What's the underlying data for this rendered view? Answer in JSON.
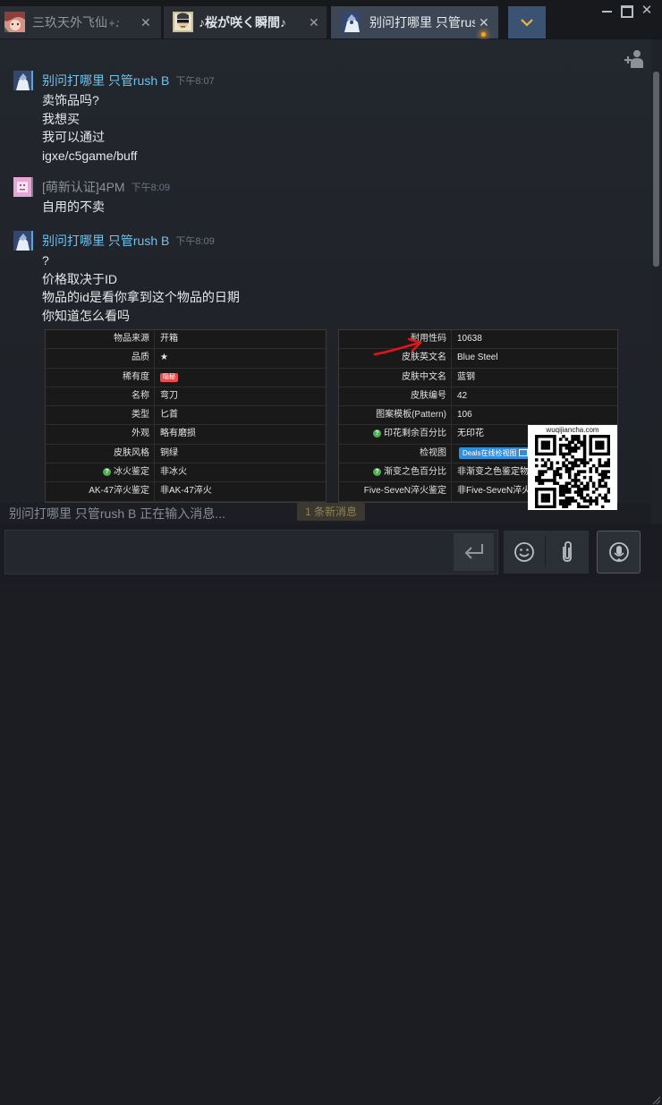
{
  "tabs": [
    {
      "label": "三玖天外飞仙",
      "active": false
    },
    {
      "label": "♪桜が咲く瞬間♪",
      "active": false
    },
    {
      "label": "别问打哪里 只管rus",
      "active": true
    }
  ],
  "messages": [
    {
      "sender": "别问打哪里 只管rush B",
      "time": "下午8:07",
      "lines": [
        "卖饰品吗?",
        "我想买",
        "我可以通过",
        "igxe/c5game/buff"
      ]
    },
    {
      "sender": "[萌新认证]4PM",
      "time": "下午8:09",
      "lines": [
        "自用的不卖"
      ]
    },
    {
      "sender": "别问打哪里 只管rush B",
      "time": "下午8:09",
      "lines": [
        "?",
        "价格取决于ID",
        "物品的id是看你拿到这个物品的日期",
        "你知道怎么看吗"
      ]
    }
  ],
  "item_table": {
    "left": [
      {
        "label": "物品来源",
        "value": "开箱"
      },
      {
        "label": "品质",
        "value": "★"
      },
      {
        "label": "稀有度",
        "badge": "隐秘"
      },
      {
        "label": "名称",
        "value": "弯刀"
      },
      {
        "label": "类型",
        "value": "匕首"
      },
      {
        "label": "外观",
        "value": "略有磨损"
      },
      {
        "label": "皮肤风格",
        "value": "铜绿"
      },
      {
        "label": "冰火鉴定",
        "value": "非冰火",
        "help": true
      },
      {
        "label": "AK-47淬火鉴定",
        "value": "非AK-47淬火"
      }
    ],
    "right": [
      {
        "label": "耐用性码",
        "value": "10638"
      },
      {
        "label": "皮肤英文名",
        "value": "Blue Steel"
      },
      {
        "label": "皮肤中文名",
        "value": "蓝钢"
      },
      {
        "label": "皮肤编号",
        "value": "42"
      },
      {
        "label": "图案模板(Pattern)",
        "value": "106"
      },
      {
        "label": "印花剩余百分比",
        "value": "无印花",
        "help": true
      },
      {
        "label": "检视图",
        "button": "Deals在线检视图"
      },
      {
        "label": "渐变之色百分比",
        "value": "非渐变之色鉴定物品",
        "help": true
      },
      {
        "label": "Five-SeveN淬火鉴定",
        "value": "非Five-SeveN淬火"
      }
    ]
  },
  "status": {
    "typing": "别问打哪里 只管rush B 正在输入消息...",
    "new_messages": "1 条新消息"
  },
  "input": {
    "value": "",
    "placeholder": ""
  },
  "watermark": {
    "caption": "wuqijiancha.com"
  },
  "colors": {
    "sender_online": "#6cc4ef",
    "sender_offline": "#8c9198",
    "timestamp": "#6b7380",
    "message_text": "#e6e7e9",
    "active_tab": "#3d4654",
    "dropdown_bg": "#3a5372",
    "dropdown_chevron": "#f0b73a",
    "unread_dot": "#f6a623",
    "rarity_badge": "#eb4b4b",
    "inspect_button": "#2f8ede",
    "help_icon": "#4caf50",
    "annotation_arrow": "#e3141b"
  },
  "icons": {
    "tab_close": "close-icon",
    "dropdown": "chevron-down-icon",
    "add_friend": "add-friend-icon",
    "send": "enter-icon",
    "emoji": "smiley-icon",
    "attach": "paperclip-icon",
    "voice": "microphone-icon"
  }
}
